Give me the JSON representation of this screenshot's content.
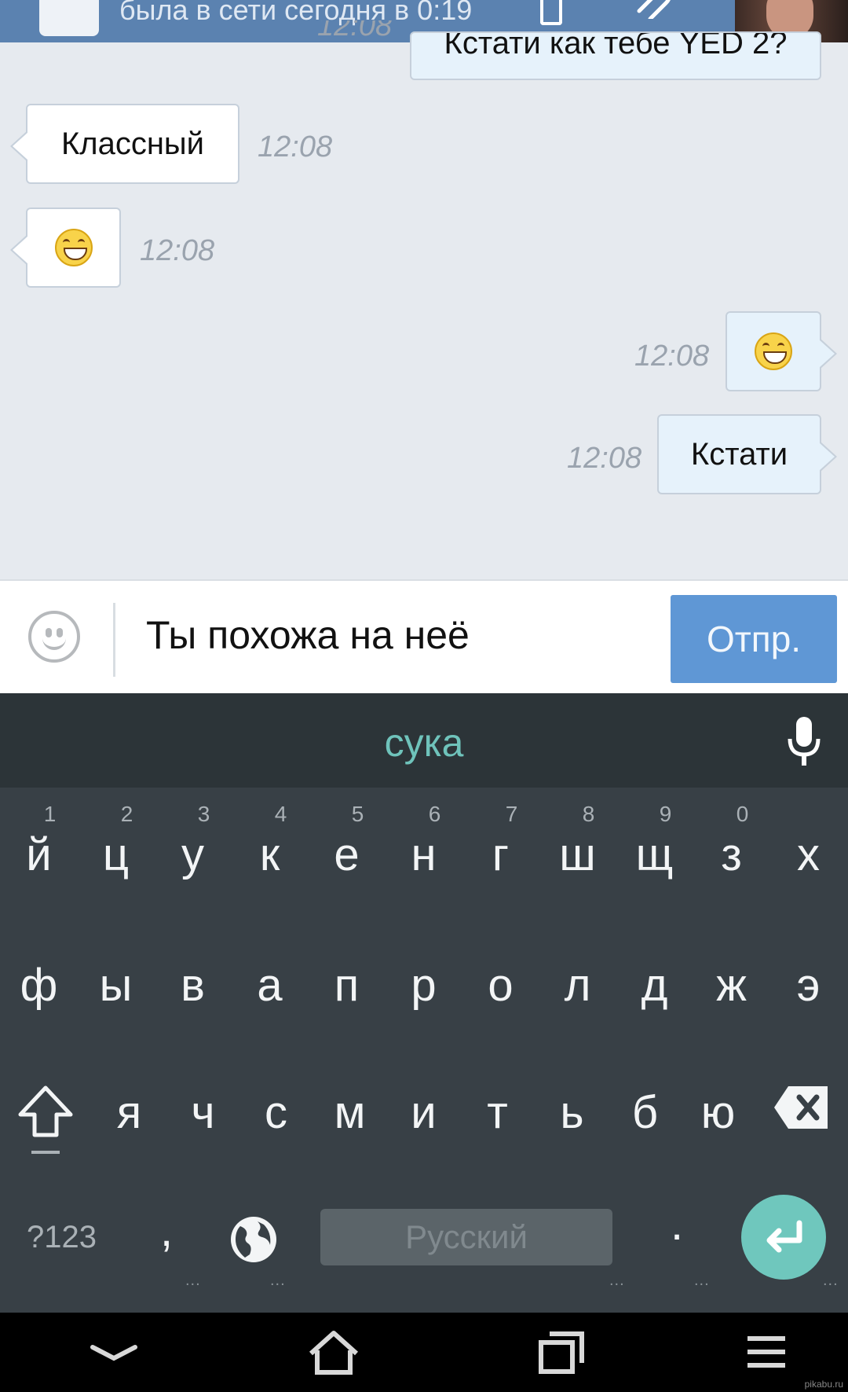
{
  "header": {
    "status": "была в сети сегодня в 0:19"
  },
  "messages": [
    {
      "direction": "out",
      "text": "Кстати как тебе YED 2?",
      "time": "12:08"
    },
    {
      "direction": "in",
      "text": "Классный",
      "time": "12:08"
    },
    {
      "direction": "in",
      "emoji": "grinning-face",
      "time": "12:08"
    },
    {
      "direction": "out",
      "emoji": "grinning-face",
      "time": "12:08"
    },
    {
      "direction": "out",
      "text": "Кстати",
      "time": "12:08"
    }
  ],
  "composer": {
    "input_value": "Ты похожа на неё",
    "send_label": "Отпр."
  },
  "keyboard": {
    "suggestion": "сука",
    "row1": [
      {
        "hint": "1",
        "key": "й"
      },
      {
        "hint": "2",
        "key": "ц"
      },
      {
        "hint": "3",
        "key": "у"
      },
      {
        "hint": "4",
        "key": "к"
      },
      {
        "hint": "5",
        "key": "е"
      },
      {
        "hint": "6",
        "key": "н"
      },
      {
        "hint": "7",
        "key": "г"
      },
      {
        "hint": "8",
        "key": "ш"
      },
      {
        "hint": "9",
        "key": "щ"
      },
      {
        "hint": "0",
        "key": "з"
      },
      {
        "hint": "",
        "key": "х"
      }
    ],
    "row2": [
      "ф",
      "ы",
      "в",
      "а",
      "п",
      "р",
      "о",
      "л",
      "д",
      "ж",
      "э"
    ],
    "row3": [
      "я",
      "ч",
      "с",
      "м",
      "и",
      "т",
      "ь",
      "б",
      "ю"
    ],
    "symbols_label": "?123",
    "comma": ",",
    "space_label": "Русский",
    "period": ".",
    "dots": "..."
  },
  "colors": {
    "header": "#5b82b0",
    "chat_background": "#e6eaef",
    "send_button": "#5f97d5",
    "keyboard": "#384046",
    "accent": "#6fc7bd"
  },
  "watermark": "pikabu.ru"
}
